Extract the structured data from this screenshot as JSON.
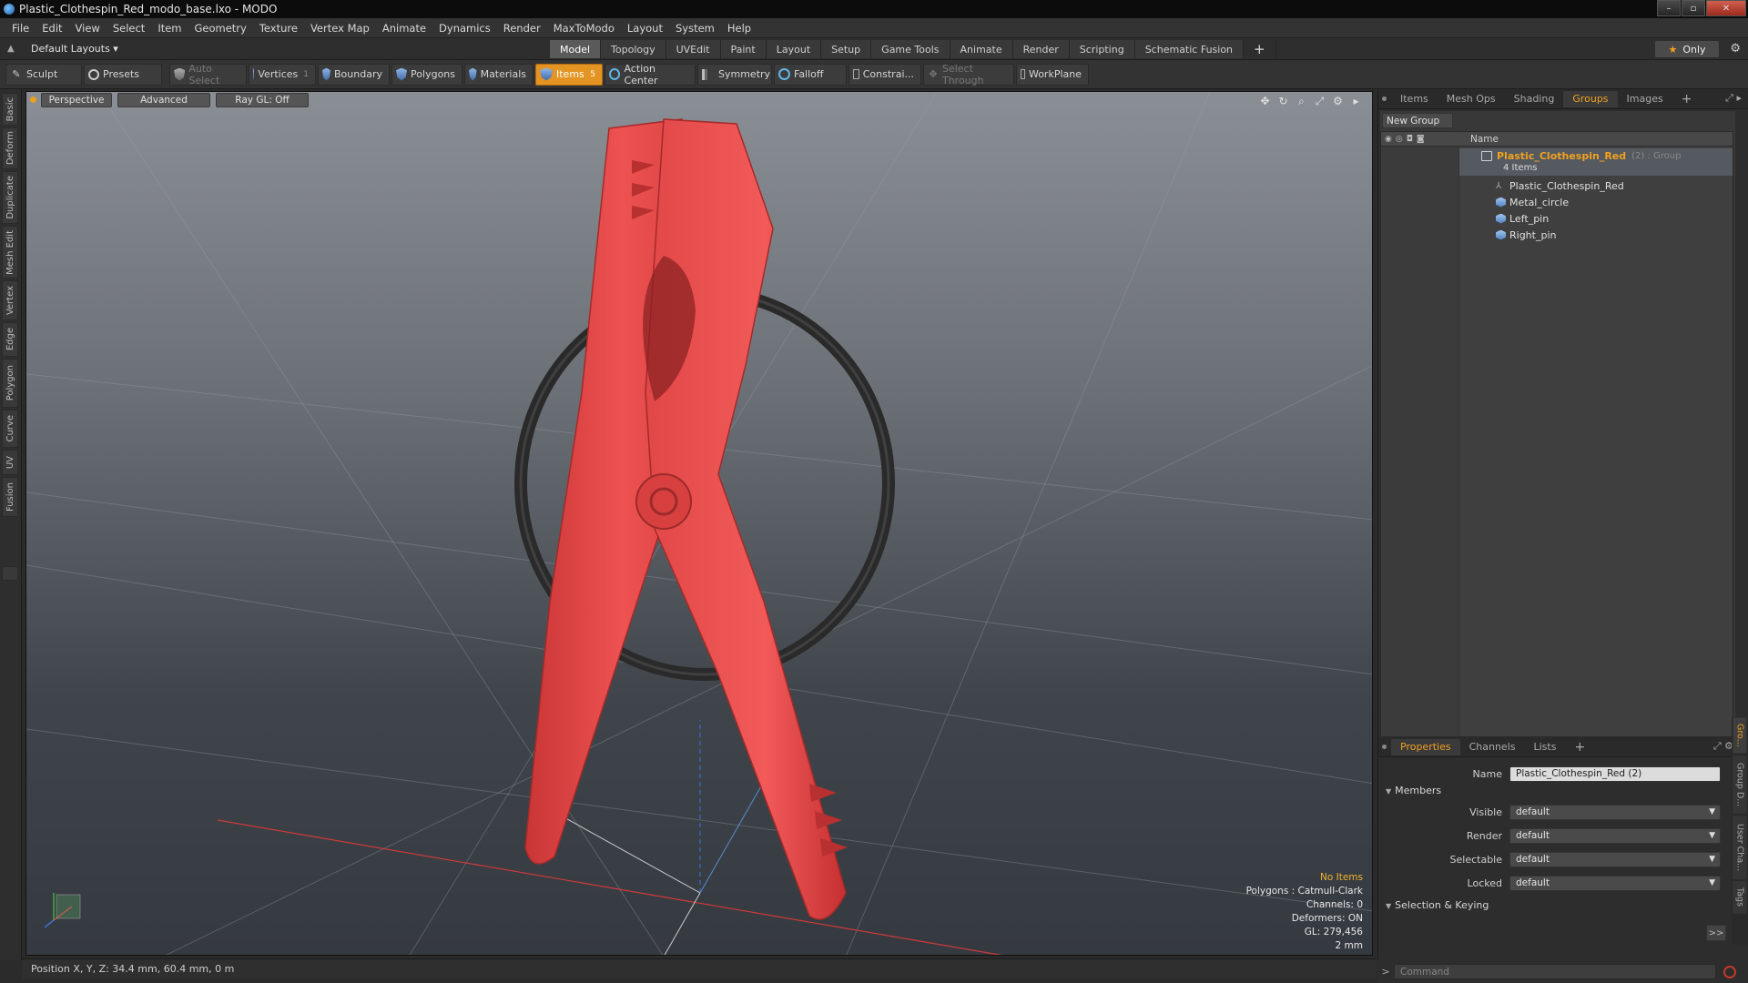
{
  "window": {
    "title": "Plastic_Clothespin_Red_modo_base.lxo - MODO"
  },
  "menu": [
    "File",
    "Edit",
    "View",
    "Select",
    "Item",
    "Geometry",
    "Texture",
    "Vertex Map",
    "Animate",
    "Dynamics",
    "Render",
    "MaxToModo",
    "Layout",
    "System",
    "Help"
  ],
  "layoutbar": {
    "layouts_label": "Default Layouts ▾",
    "tabs": [
      "Model",
      "Topology",
      "UVEdit",
      "Paint",
      "Layout",
      "Setup",
      "Game Tools",
      "Animate",
      "Render",
      "Scripting",
      "Schematic Fusion"
    ],
    "active_tab": "Model",
    "plus": "+",
    "only_label": "Only"
  },
  "toolbar": {
    "sculpt": "Sculpt",
    "presets": "Presets",
    "auto_select": "Auto Select",
    "vertices": "Vertices",
    "vertices_count": "1",
    "boundary": "Boundary",
    "polygons": "Polygons",
    "materials": "Materials",
    "items": "Items",
    "items_count": "5",
    "action_center": "Action Center",
    "symmetry": "Symmetry",
    "falloff": "Falloff",
    "constraints": "Constrai...",
    "select_through": "Select Through",
    "workplane": "WorkPlane"
  },
  "left_tabs": [
    "Basic",
    "Deform",
    "Duplicate",
    "Mesh Edit",
    "Vertex",
    "Edge",
    "Polygon",
    "Curve",
    "UV",
    "Fusion"
  ],
  "viewport": {
    "view_mode": "Perspective",
    "shading": "Advanced",
    "raygl": "Ray GL: Off",
    "info": {
      "selection": "No Items",
      "polygons": "Polygons : Catmull-Clark",
      "channels": "Channels: 0",
      "deformers": "Deformers: ON",
      "gl": "GL: 279,456",
      "grid": "2 mm"
    },
    "colors": {
      "clothespin": "#e84a4a",
      "ring": "#2a2a2a",
      "x_axis": "#d03a3a",
      "z_axis": "#3a6ad0"
    }
  },
  "status": {
    "position": "Position X, Y, Z:  34.4 mm, 60.4 mm, 0 m"
  },
  "groups_panel": {
    "tabs": [
      "Items",
      "Mesh Ops",
      "Shading",
      "Groups",
      "Images"
    ],
    "active_tab": "Groups",
    "plus": "+",
    "new_group": "New Group",
    "column_name": "Name",
    "group": {
      "name": "Plastic_Clothespin_Red",
      "suffix": "(2) : Group",
      "count": "4 Items"
    },
    "items": [
      {
        "name": "Plastic_Clothespin_Red",
        "icon": "locator-icon"
      },
      {
        "name": "Metal_circle",
        "icon": "mesh-icon"
      },
      {
        "name": "Left_pin",
        "icon": "mesh-icon"
      },
      {
        "name": "Right_pin",
        "icon": "mesh-icon"
      }
    ]
  },
  "properties_panel": {
    "tabs": [
      "Properties",
      "Channels",
      "Lists"
    ],
    "active_tab": "Properties",
    "plus": "+",
    "name_label": "Name",
    "name_value": "Plastic_Clothespin_Red (2)",
    "members_section": "Members",
    "fields": [
      {
        "label": "Visible",
        "value": "default"
      },
      {
        "label": "Render",
        "value": "default"
      },
      {
        "label": "Selectable",
        "value": "default"
      },
      {
        "label": "Locked",
        "value": "default"
      }
    ],
    "keying_section": "Selection & Keying",
    "more": ">>",
    "side_tabs": [
      "Gro...",
      "Group D...",
      "User Cha...",
      "Tags"
    ]
  },
  "command": {
    "placeholder": "Command"
  }
}
